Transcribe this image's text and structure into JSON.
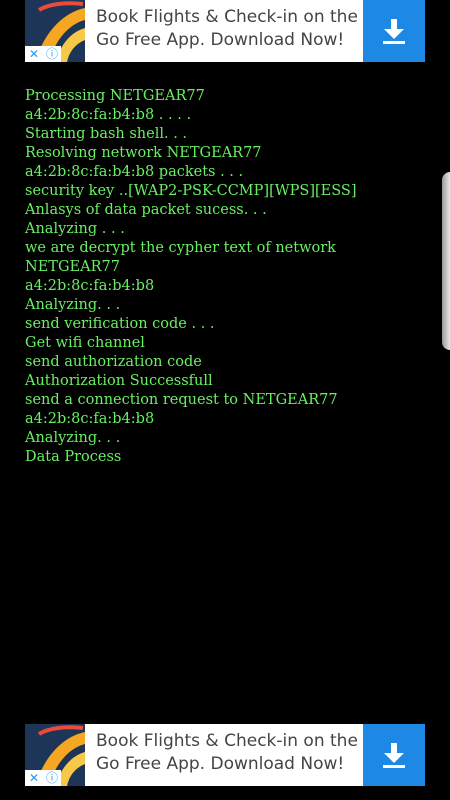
{
  "ads": {
    "top": {
      "line1": "Book Flights & Check-in on the",
      "line2": "Go Free App. Download Now!",
      "close_glyph": "✕",
      "info_glyph": "ⓘ"
    },
    "bottom": {
      "line1": "Book Flights & Check-in on the",
      "line2": "Go Free App. Download Now!",
      "close_glyph": "✕",
      "info_glyph": "ⓘ"
    }
  },
  "console": {
    "lines": [
      "Processing NETGEAR77",
      "a4:2b:8c:fa:b4:b8 . . . .",
      "Starting bash shell. . .",
      "Resolving network NETGEAR77",
      "a4:2b:8c:fa:b4:b8 packets . . .",
      "security key ..[WAP2-PSK-CCMP][WPS][ESS]",
      "Anlasys of data packet sucess. . .",
      "Analyzing . . .",
      "we are decrypt the cypher text of network",
      "NETGEAR77",
      "a4:2b:8c:fa:b4:b8",
      "Analyzing. . .",
      "send verification code . . .",
      "Get wifi channel",
      "send authorization code",
      "Authorization Successfull",
      "send a connection request to NETGEAR77",
      "a4:2b:8c:fa:b4:b8",
      "Analyzing. . .",
      "Data Process"
    ]
  },
  "colors": {
    "background": "#000000",
    "console_text": "#69f062",
    "ad_background": "#ffffff",
    "ad_text": "#444444",
    "download_button": "#1e88e5",
    "ad_badge": "#2196f3"
  },
  "icons": {
    "ad_logo": "airline-logo-icon",
    "download": "download-arrow-icon",
    "close": "close-icon",
    "info": "info-icon"
  }
}
